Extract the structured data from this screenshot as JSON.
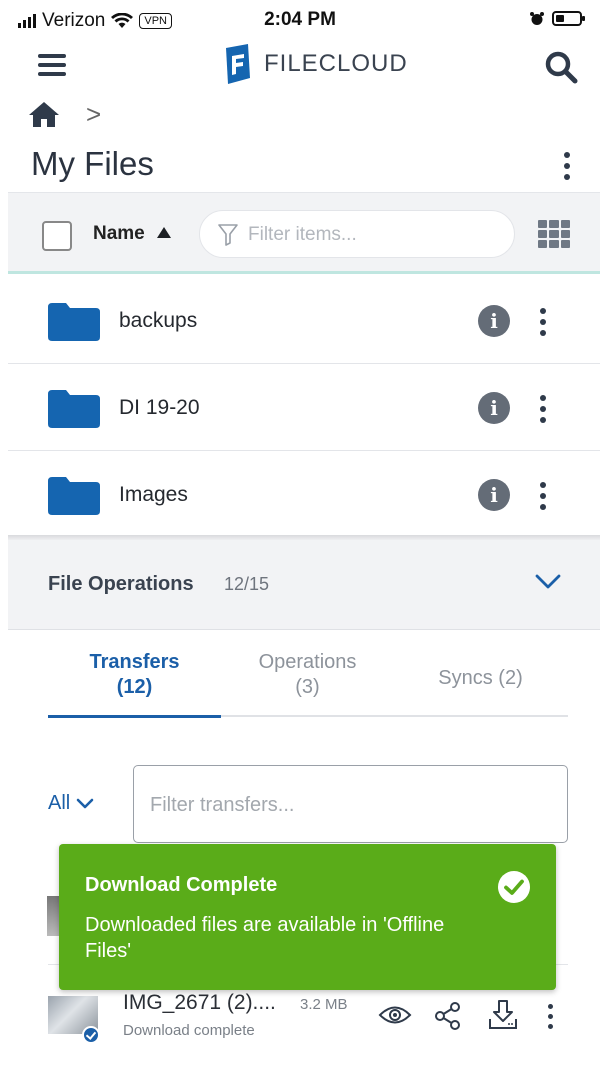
{
  "status_bar": {
    "carrier": "Verizon",
    "vpn": "VPN",
    "time": "2:04 PM",
    "battery_level": 0.35
  },
  "header": {
    "logo_text": "FILECLOUD"
  },
  "breadcrumb": {
    "separator": ">"
  },
  "page": {
    "title": "My Files"
  },
  "toolbar": {
    "sort_label": "Name",
    "filter_placeholder": "Filter items..."
  },
  "files": [
    {
      "name": "backups"
    },
    {
      "name": "DI 19-20"
    },
    {
      "name": "Images"
    }
  ],
  "file_operations": {
    "title": "File Operations",
    "count": "12/15",
    "tabs": [
      {
        "label": "Transfers",
        "count": "(12)",
        "active": true
      },
      {
        "label": "Operations",
        "count": "(3)",
        "active": false
      },
      {
        "label": "Syncs (2)",
        "active": false
      }
    ],
    "scope": "All",
    "filter_placeholder": "Filter transfers...",
    "transfers": [
      {
        "name": "IMG_2671 (2)....",
        "size": "3.2 MB",
        "status": "Download complete"
      }
    ]
  },
  "toast": {
    "title": "Download Complete",
    "message": "Downloaded files are available in 'Offline Files'",
    "color": "#5aac19"
  },
  "colors": {
    "accent": "#1b5fa8",
    "folder": "#1565b0",
    "toast": "#5aac19"
  }
}
